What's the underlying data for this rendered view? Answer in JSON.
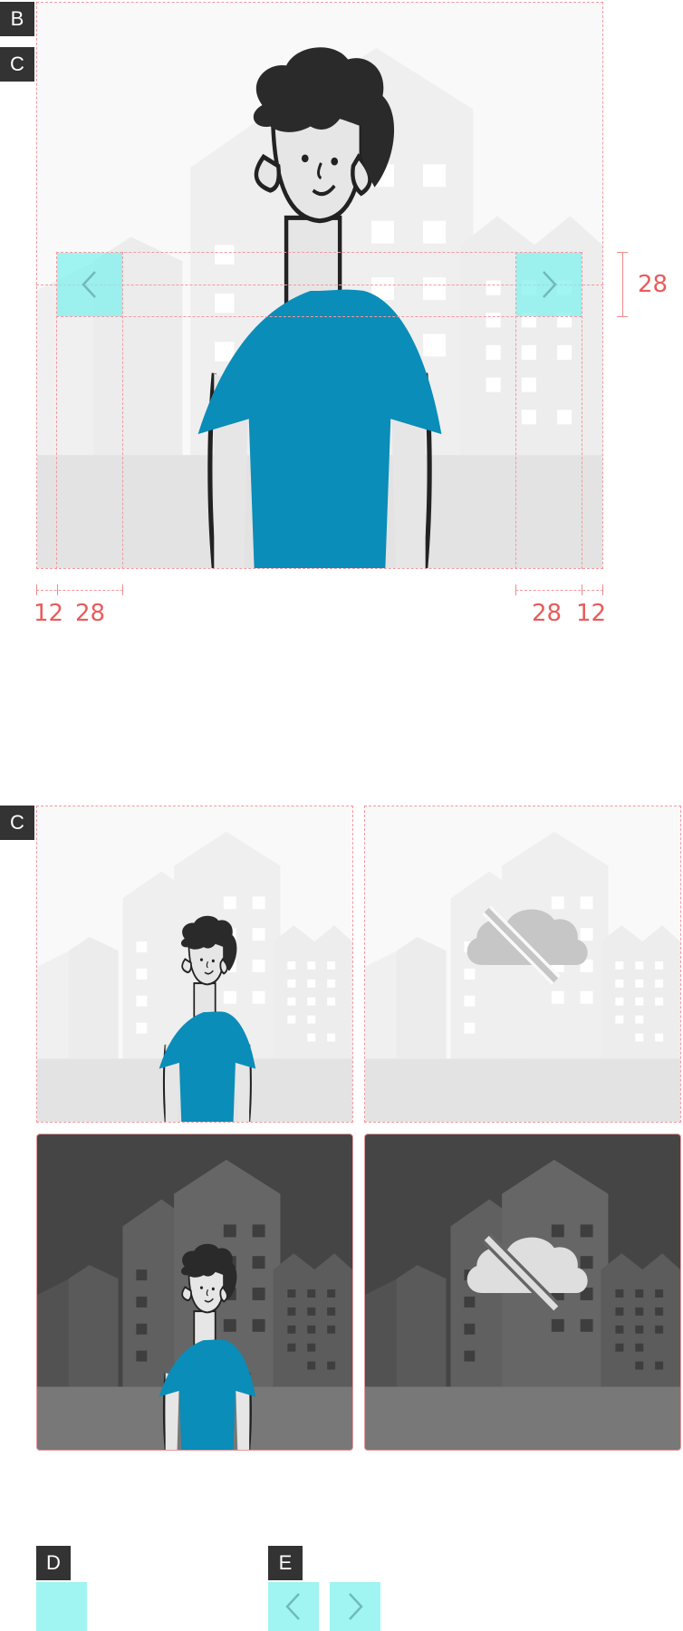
{
  "section_labels": {
    "b": "B",
    "c_top": "C",
    "c_bottom": "C",
    "d": "D",
    "e": "E"
  },
  "measurements": {
    "left_margin": "12",
    "left_button": "28",
    "right_button": "28",
    "right_margin": "12",
    "button_height": "28"
  },
  "icons": {
    "prev": "chevron-left-icon",
    "next": "chevron-right-icon",
    "broken_image": "cloud-off-icon"
  },
  "colors": {
    "highlight": "#80f0ee",
    "guide": "#f19aa0",
    "dimension_text": "#e85c5c",
    "shirt": "#0a8db8",
    "hair": "#2a2a2a",
    "dark_sky": "#454545",
    "light_sky": "#f9f9f9"
  }
}
